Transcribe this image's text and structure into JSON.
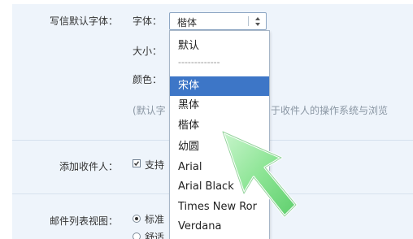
{
  "settings": {
    "font_row": {
      "label": "写信默认字体：",
      "font_label": "字体：",
      "font_value": "楷体",
      "size_label": "大小：",
      "color_label": "颜色：",
      "note_left": "(默认字",
      "note_right": "于收件人的操作系统与浏览"
    },
    "recipient_row": {
      "label": "添加收件人：",
      "checkbox_label": "支持"
    },
    "maillist_row": {
      "label": "邮件列表视图：",
      "option_standard": "标准",
      "option_second": "舒适"
    }
  },
  "font_dropdown": {
    "options": [
      "默认",
      "-------------",
      "宋体",
      "黑体",
      "楷体",
      "幼圆",
      "Arial",
      "Arial Black",
      "Times New Ror",
      "Verdana"
    ],
    "highlighted_index": 2
  },
  "colors": {
    "panel_bg": "#eef4fb",
    "highlight": "#3d76c7",
    "cursor_green": "#7fe28a"
  }
}
